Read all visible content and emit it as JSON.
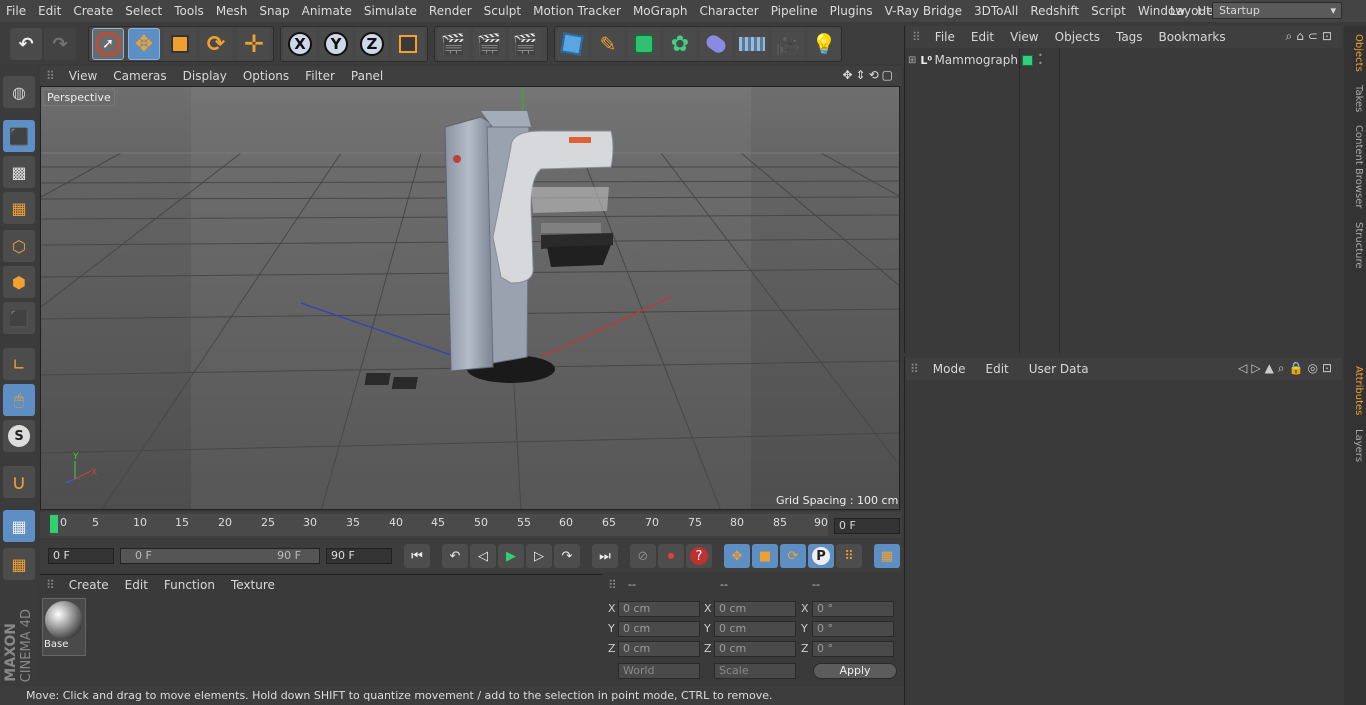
{
  "menubar": {
    "items": [
      "File",
      "Edit",
      "Create",
      "Select",
      "Tools",
      "Mesh",
      "Snap",
      "Animate",
      "Simulate",
      "Render",
      "Sculpt",
      "Motion Tracker",
      "MoGraph",
      "Character",
      "Pipeline",
      "Plugins",
      "V-Ray Bridge",
      "3DToAll",
      "Redshift",
      "Script",
      "Window",
      "Help"
    ],
    "layout_label": "Layout:",
    "layout_value": "Startup"
  },
  "toolbar": {
    "axis_x": "X",
    "axis_y": "Y",
    "axis_z": "Z"
  },
  "viewport": {
    "menu": [
      "View",
      "Cameras",
      "Display",
      "Options",
      "Filter",
      "Panel"
    ],
    "camera": "Perspective",
    "grid_spacing": "Grid Spacing : 100 cm",
    "axis_y": "Y",
    "axis_x": "X"
  },
  "timeline": {
    "ticks": [
      "0",
      "5",
      "10",
      "15",
      "20",
      "25",
      "30",
      "35",
      "40",
      "45",
      "50",
      "55",
      "60",
      "65",
      "70",
      "75",
      "80",
      "85",
      "90"
    ],
    "current_frame": "0 F",
    "start_frame": "0 F",
    "range_start": "0 F",
    "range_end": "90 F",
    "end_frame": "90 F"
  },
  "materials": {
    "menu": [
      "Create",
      "Edit",
      "Function",
      "Texture"
    ],
    "item": "Base"
  },
  "coords": {
    "headers": [
      "--",
      "--",
      "--"
    ],
    "rows": [
      {
        "axis": "X",
        "pos": "0 cm",
        "size": "0 cm",
        "rot": "0 °"
      },
      {
        "axis": "Y",
        "pos": "0 cm",
        "size": "0 cm",
        "rot": "0 °"
      },
      {
        "axis": "Z",
        "pos": "0 cm",
        "size": "0 cm",
        "rot": "0 °"
      }
    ],
    "mode": "World",
    "scale": "Scale",
    "apply": "Apply"
  },
  "status": "Move: Click and drag to move elements. Hold down SHIFT to quantize movement / add to the selection in point mode, CTRL to remove.",
  "objects": {
    "menu": [
      "File",
      "Edit",
      "View",
      "Objects",
      "Tags",
      "Bookmarks"
    ],
    "item": "Mammograph"
  },
  "attributes": {
    "menu": [
      "Mode",
      "Edit",
      "User Data"
    ]
  },
  "right_tabs": [
    "Objects",
    "Takes",
    "Content Browser",
    "Structure",
    "Attributes",
    "Layers"
  ],
  "branding": {
    "brand": "MAXON",
    "product": "CINEMA 4D"
  }
}
